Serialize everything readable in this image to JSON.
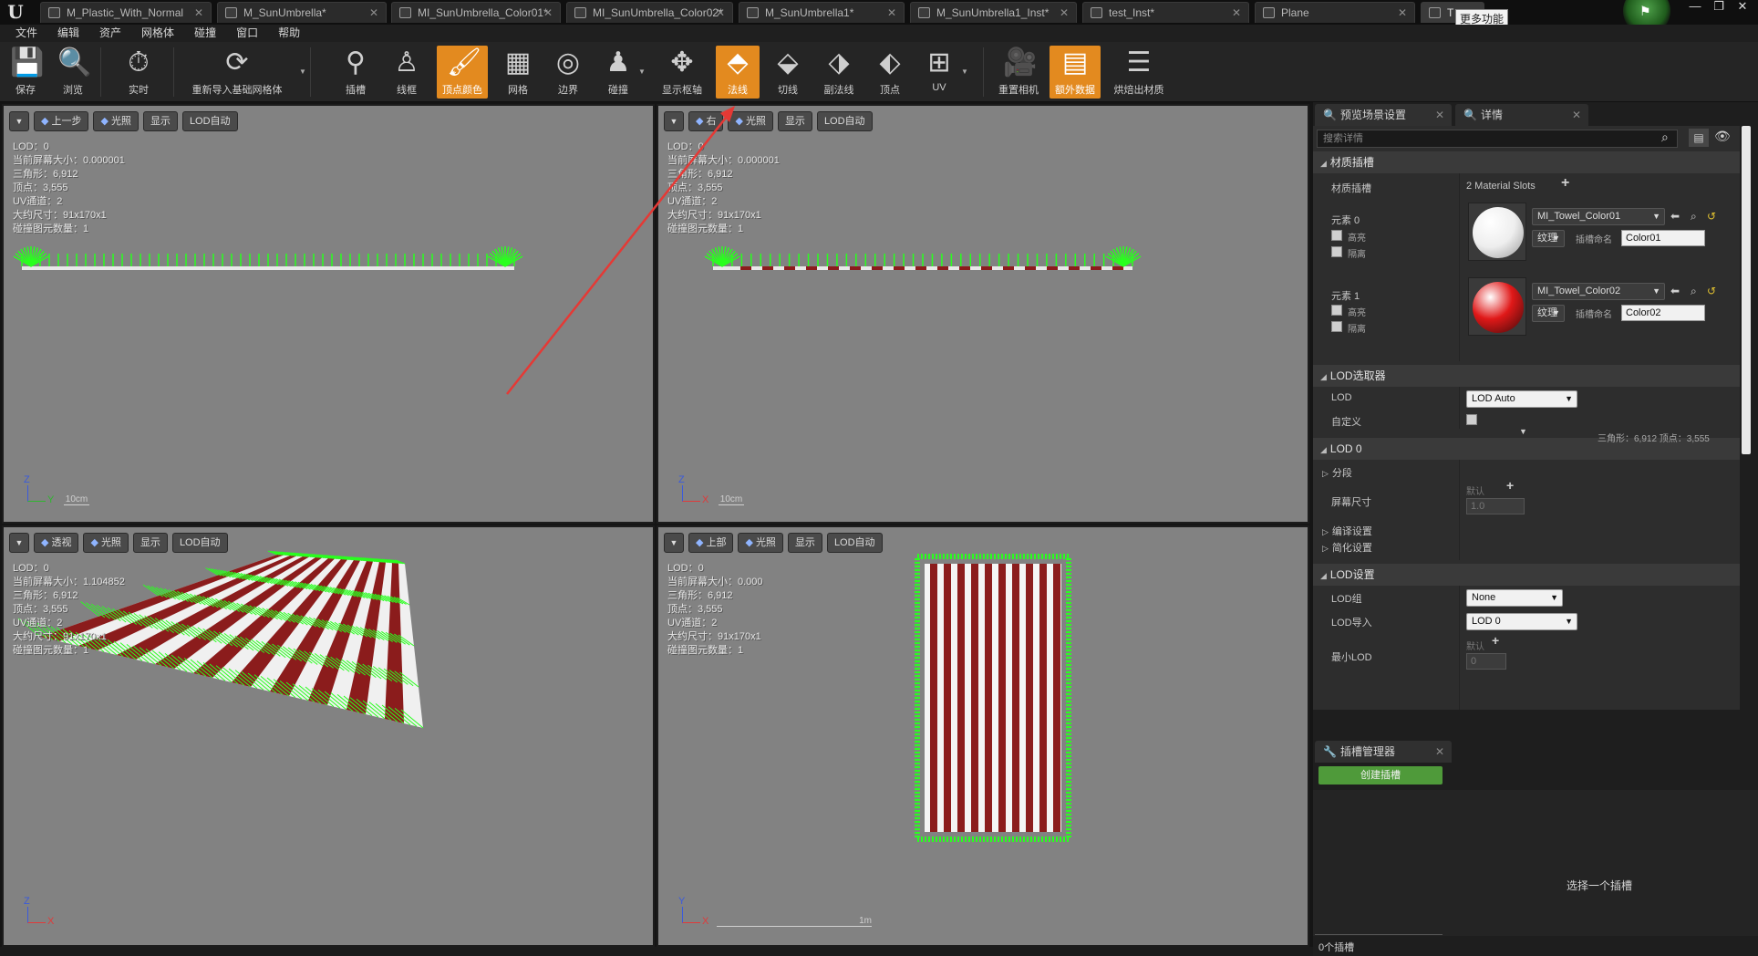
{
  "tabs": [
    {
      "label": "M_Plastic_With_Normal",
      "active": false
    },
    {
      "label": "M_SunUmbrella*",
      "active": false
    },
    {
      "label": "MI_SunUmbrella_Color01*",
      "active": false
    },
    {
      "label": "MI_SunUmbrella_Color02*",
      "active": false
    },
    {
      "label": "M_SunUmbrella1*",
      "active": false
    },
    {
      "label": "M_SunUmbrella1_Inst*",
      "active": false
    },
    {
      "label": "test_Inst*",
      "active": false
    },
    {
      "label": "Plane",
      "active": false
    },
    {
      "label": "T",
      "active": true
    }
  ],
  "tooltip": "更多功能",
  "menu": [
    "文件",
    "编辑",
    "资产",
    "网格体",
    "碰撞",
    "窗口",
    "帮助"
  ],
  "toolbar": {
    "save": "保存",
    "browse": "浏览",
    "realtime": "实时",
    "reimport": "重新导入基础网格体",
    "sockets": "插槽",
    "wireframe": "线框",
    "vertex_colors": "顶点颜色",
    "grid": "网格",
    "bounds": "边界",
    "collision": "碰撞",
    "show_pivot": "显示枢轴",
    "normals": "法线",
    "tangents": "切线",
    "binormals": "副法线",
    "vertices": "顶点",
    "uv": "UV",
    "reset_camera": "重置相机",
    "additional_data": "额外数据",
    "bake_materials": "烘焙出材质"
  },
  "viewports": [
    {
      "view": "上一步",
      "lit": "光照",
      "show": "显示",
      "lod": "LOD自动",
      "stats": [
        "LOD：0",
        "当前屏幕大小：0.000001",
        "三角形：6,912",
        "顶点：3,555",
        "UV通道：2",
        "大约尺寸：91x170x1",
        "碰撞图元数量：1"
      ],
      "scale": "10cm",
      "axis_v": "Z",
      "axis_h": "Y"
    },
    {
      "view": "右",
      "lit": "光照",
      "show": "显示",
      "lod": "LOD自动",
      "stats": [
        "LOD：0",
        "当前屏幕大小：0.000001",
        "三角形：6,912",
        "顶点：3,555",
        "UV通道：2",
        "大约尺寸：91x170x1",
        "碰撞图元数量：1"
      ],
      "scale": "10cm",
      "axis_v": "Z",
      "axis_h": "X"
    },
    {
      "view": "透视",
      "lit": "光照",
      "show": "显示",
      "lod": "LOD自动",
      "stats": [
        "LOD：0",
        "当前屏幕大小：1.104852",
        "三角形：6,912",
        "顶点：3,555",
        "UV通道：2",
        "大约尺寸：91x170x1",
        "碰撞图元数量：1"
      ],
      "scale": "",
      "axis_v": "Z",
      "axis_h": "X"
    },
    {
      "view": "上部",
      "lit": "光照",
      "show": "显示",
      "lod": "LOD自动",
      "stats": [
        "LOD：0",
        "当前屏幕大小：0.000",
        "三角形：6,912",
        "顶点：3,555",
        "UV通道：2",
        "大约尺寸：91x170x1",
        "碰撞图元数量：1"
      ],
      "scale": "1m",
      "axis_v": "Y",
      "axis_h": "X"
    }
  ],
  "panel": {
    "tab_preview": "预览场景设置",
    "tab_details": "详情",
    "search_placeholder": "搜索详情",
    "material_slots_cat": "材质插槽",
    "material_slots_label": "材质插槽",
    "material_slots_value": "2 Material Slots",
    "elements": [
      {
        "label": "元素 0",
        "highlight": "高亮",
        "isolate": "隔离",
        "material": "MI_Towel_Color01",
        "texture": "纹理",
        "slot_name_label": "插槽命名",
        "slot_name": "Color01",
        "ball_color": "#f4f4f4"
      },
      {
        "label": "元素 1",
        "highlight": "高亮",
        "isolate": "隔离",
        "material": "MI_Towel_Color02",
        "texture": "纹理",
        "slot_name_label": "插槽命名",
        "slot_name": "Color02",
        "ball_color": "#e01818"
      }
    ],
    "lod_picker_cat": "LOD选取器",
    "lod_label": "LOD",
    "lod_value": "LOD Auto",
    "custom_label": "自定义",
    "lod0_cat": "LOD 0",
    "lod0_stats": "三角形：6,912    顶点：3,555",
    "sections": "分段",
    "screen_size": "屏幕尺寸",
    "default_label": "默认",
    "screen_size_value": "1.0",
    "build_settings": "编译设置",
    "reduction_settings": "简化设置",
    "lod_settings_cat": "LOD设置",
    "lod_group_label": "LOD组",
    "lod_group_value": "None",
    "lod_import_label": "LOD导入",
    "lod_import_value": "LOD 0",
    "min_lod_label": "最小LOD",
    "min_lod_default": "默认",
    "min_lod_value": "0"
  },
  "socket_manager": {
    "title": "插槽管理器",
    "create_button": "创建插槽",
    "hint": "选择一个插槽",
    "count": "0个插槽"
  },
  "colors": {
    "accent_active": "#e38a1f",
    "normals_green": "#29ff1e",
    "stripe_red": "#8b1c1c",
    "create_green": "#4f9a3a"
  }
}
